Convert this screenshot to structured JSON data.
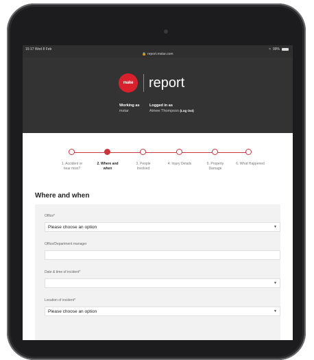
{
  "status_bar": {
    "time": "15:17  Wed 8 Feb",
    "battery": "99%",
    "url": "report.mstar.com"
  },
  "header": {
    "logo_text": "make",
    "title": "report",
    "working_as_label": "Working as",
    "working_as_value": "mstar",
    "logged_in_label": "Logged in as",
    "logged_in_value": "Aimee Thompson",
    "logout_label": "(Log Out)"
  },
  "stepper": {
    "current_index": 1,
    "steps": [
      {
        "line1": "1. Accident or",
        "line2": "near miss?"
      },
      {
        "line1": "2. Where and",
        "line2": "when"
      },
      {
        "line1": "3. People",
        "line2": "Involved"
      },
      {
        "line1": "4. Injury Details",
        "line2": ""
      },
      {
        "line1": "5. Property",
        "line2": "Damage"
      },
      {
        "line1": "6. What Happened",
        "line2": ""
      }
    ]
  },
  "form": {
    "section_title": "Where and when",
    "office_label": "Office*",
    "office_value": "Please choose an option",
    "manager_label": "Office/Department manager",
    "manager_value": "",
    "datetime_label": "Date & time of incident*",
    "datetime_value": "",
    "location_label": "Location of incident*",
    "location_value": "Please choose an option"
  },
  "colors": {
    "accent": "#c9353d",
    "header_bg": "#333333",
    "panel_bg": "#f2f2f2"
  }
}
